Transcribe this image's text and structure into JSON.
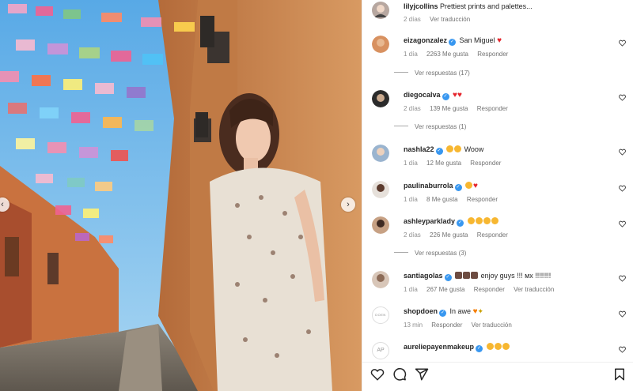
{
  "photo": {
    "prev_icon": "chevron-left-icon",
    "next_icon": "chevron-right-icon"
  },
  "caption": {
    "username": "lilyjcollins",
    "text": "Prettiest prints and palettes...",
    "time": "2 días",
    "translate": "Ver traducción"
  },
  "comments": [
    {
      "username": "eizagonzalez",
      "verified": true,
      "text": "San Miguel",
      "emoji": [
        "heart"
      ],
      "time": "1 día",
      "likes": "2263 Me gusta",
      "reply": "Responder",
      "replies": "Ver respuestas (17)"
    },
    {
      "username": "diegocalva",
      "verified": true,
      "text": "",
      "emoji": [
        "heart",
        "heart"
      ],
      "time": "2 días",
      "likes": "139 Me gusta",
      "reply": "Responder",
      "replies": "Ver respuestas (1)"
    },
    {
      "username": "nashla22",
      "verified": true,
      "text": "Woow",
      "emoji": [
        "heart-eyes",
        "heart-eyes"
      ],
      "time": "1 día",
      "likes": "12 Me gusta",
      "reply": "Responder"
    },
    {
      "username": "paulinaburrola",
      "verified": true,
      "text": "",
      "emoji": [
        "heart-eyes",
        "heart"
      ],
      "time": "1 día",
      "likes": "8 Me gusta",
      "reply": "Responder"
    },
    {
      "username": "ashleyparklady",
      "verified": true,
      "text": "",
      "emoji": [
        "heart-eyes",
        "heart-eyes",
        "heart-eyes",
        "heart-eyes"
      ],
      "time": "2 días",
      "likes": "226 Me gusta",
      "reply": "Responder",
      "replies": "Ver respuestas (3)"
    },
    {
      "username": "santiagolas",
      "verified": true,
      "text": "enjoy guys !!! мх !!!!!!!!",
      "emoji": [
        "family",
        "family",
        "family"
      ],
      "time": "1 día",
      "likes": "267 Me gusta",
      "reply": "Responder",
      "translate": "Ver traducción"
    },
    {
      "username": "shopdoen",
      "verified": true,
      "text": "In awe",
      "emoji": [
        "orange-heart",
        "sparkle"
      ],
      "time": "13 min",
      "reply": "Responder",
      "translate": "Ver traducción",
      "avatar_text": "DOEN"
    },
    {
      "username": "aureliepayenmakeup",
      "verified": true,
      "text": "",
      "emoji": [
        "heart-eyes",
        "heart-eyes",
        "heart-eyes"
      ],
      "avatar_text": "AP"
    }
  ],
  "actions": {
    "like": "heart-icon",
    "comment": "comment-icon",
    "share": "send-icon",
    "save": "bookmark-icon"
  },
  "colors": {
    "verified": "#3897f0",
    "heart": "#e5252c",
    "emoji": "#f7b731",
    "meta": "#8e8e8e"
  }
}
